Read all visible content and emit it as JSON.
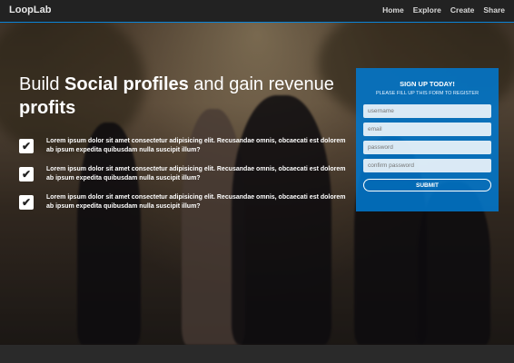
{
  "navbar": {
    "brand": "LoopLab",
    "links": [
      "Home",
      "Explore",
      "Create",
      "Share"
    ]
  },
  "hero": {
    "headline_part1": "Build ",
    "headline_strong": "Social profiles",
    "headline_part2": " and gain revenue ",
    "headline_strong2": "profits",
    "features": [
      "Lorem ipsum dolor sit amet consectetur adipisicing elit. Recusandae omnis, obcaecati est dolorem ab ipsum expedita quibusdam nulla suscipit illum?",
      "Lorem ipsum dolor sit amet consectetur adipisicing elit. Recusandae omnis, obcaecati est dolorem ab ipsum expedita quibusdam nulla suscipit illum?",
      "Lorem ipsum dolor sit amet consectetur adipisicing elit. Recusandae omnis, obcaecati est dolorem ab ipsum expedita quibusdam nulla suscipit illum?"
    ],
    "check_icon": "✔"
  },
  "signup": {
    "title": "SIGN UP TODAY!",
    "subtitle": "PLEASE FILL UP THIS FORM TO REGISTER",
    "username_placeholder": "username",
    "email_placeholder": "email",
    "password_placeholder": "password",
    "confirm_placeholder": "confirm password",
    "submit_label": "SUBMIT"
  },
  "colors": {
    "accent": "#0a7ad2",
    "navbar": "#222222"
  }
}
